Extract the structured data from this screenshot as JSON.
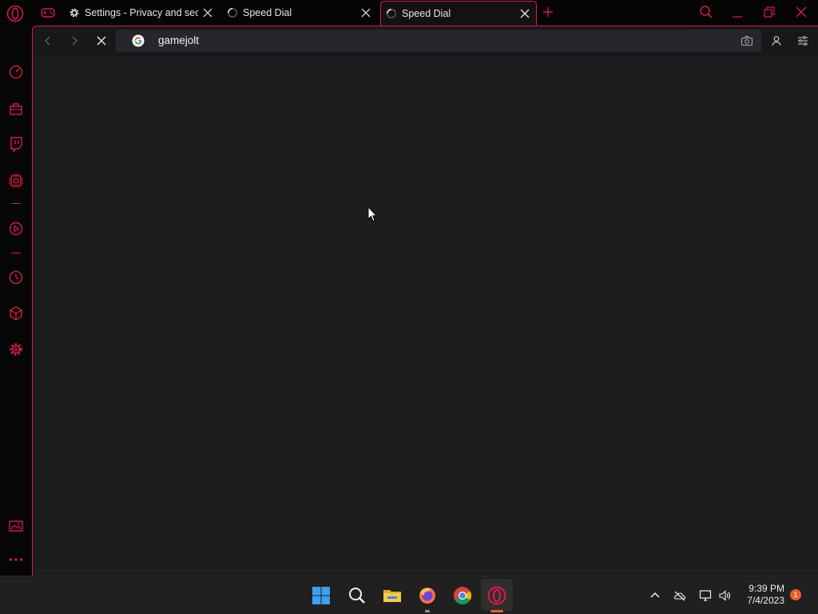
{
  "tabs": [
    {
      "title": "Settings - Privacy and security",
      "icon": "gear-icon",
      "active": false
    },
    {
      "title": "Speed Dial",
      "icon": "loading-spinner-icon",
      "active": false
    },
    {
      "title": "Speed Dial",
      "icon": "loading-spinner-icon",
      "active": true
    }
  ],
  "address_bar": {
    "value": "gamejolt",
    "search_engine_icon": "google-icon"
  },
  "sidebar": {
    "items": [
      "speedometer-icon",
      "shopping-bag-icon",
      "twitch-icon",
      "cpu-icon",
      "player-icon",
      "history-icon",
      "cube-icon",
      "settings-icon",
      "snapshot-icon",
      "more-icon"
    ]
  },
  "taskbar": {
    "apps": [
      "windows-start-icon",
      "search-icon",
      "file-explorer-icon",
      "firefox-icon",
      "chrome-icon",
      "opera-gx-icon"
    ]
  },
  "system_tray": {
    "time": "9:39 PM",
    "date": "7/4/2023",
    "notification_count": "1"
  },
  "colors": {
    "accent": "#d8194f",
    "frame_bg": "#1c1d1f",
    "taskbar_bg": "#202020"
  }
}
